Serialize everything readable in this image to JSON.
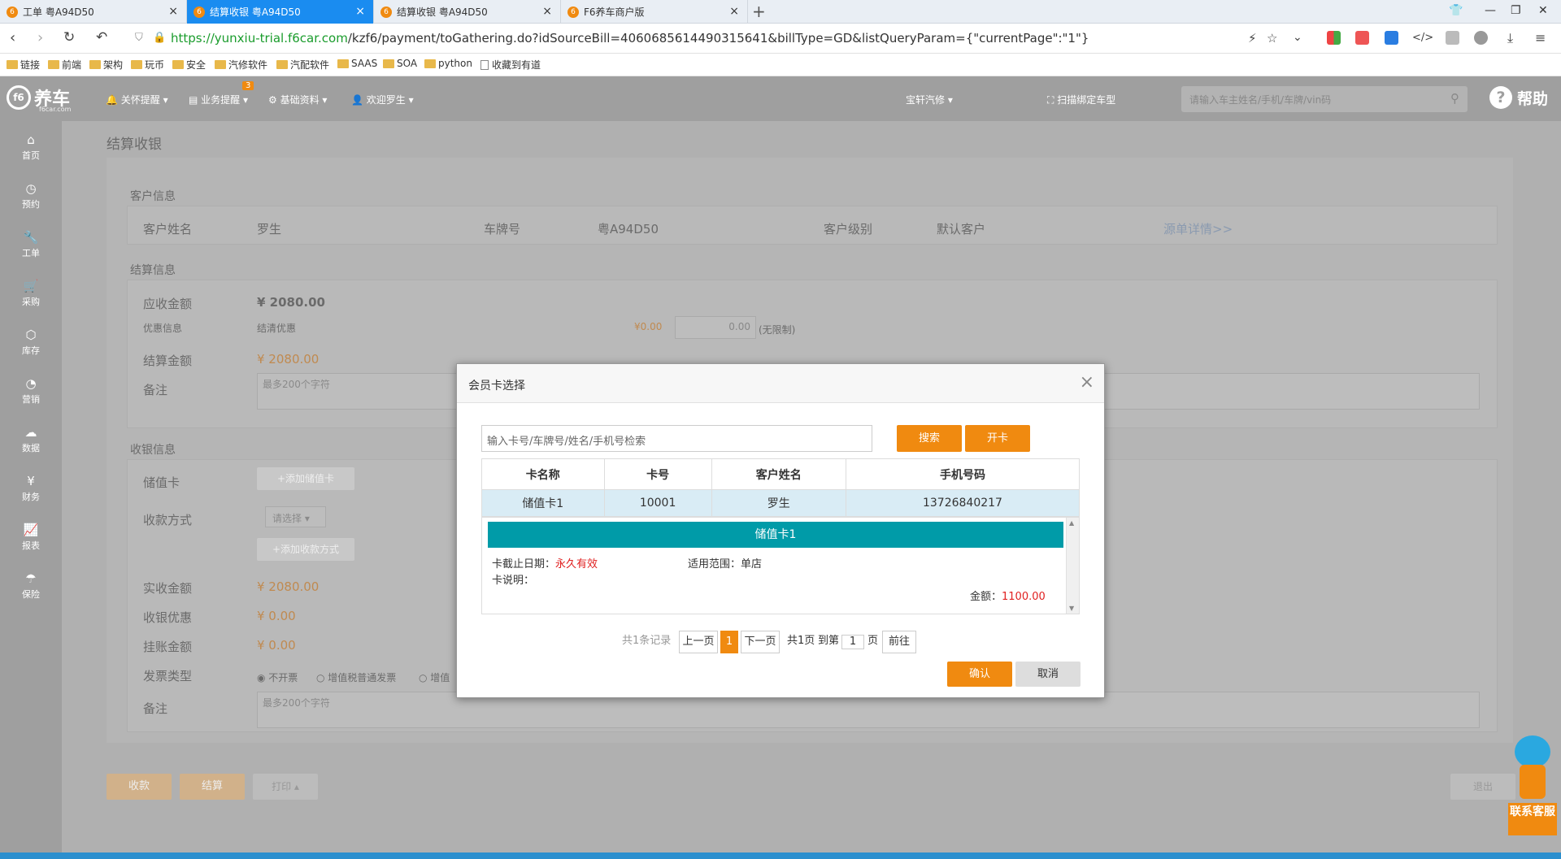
{
  "browser": {
    "tabs": [
      {
        "label": "工单 粤A94D50",
        "active": false
      },
      {
        "label": "结算收银 粤A94D50",
        "active": true
      },
      {
        "label": "结算收银 粤A94D50",
        "active": false
      },
      {
        "label": "F6养车商户版",
        "active": false
      }
    ],
    "url_host": "https://yunxiu-trial.f6car.com",
    "url_path": "/kzf6/payment/toGathering.do?idSourceBill=4060685614490315641&billType=GD&listQueryParam={\"currentPage\":\"1\"}",
    "bookmarks": [
      "链接",
      "前端",
      "架构",
      "玩币",
      "安全",
      "汽修软件",
      "汽配软件",
      "SAAS",
      "SOA",
      "python",
      "收藏到有道"
    ]
  },
  "topnav": {
    "logo": "养车",
    "logo_sub": "f6car.com",
    "items": [
      "关怀提醒",
      "业务提醒",
      "基础资料",
      "欢迎罗生"
    ],
    "badge": "3",
    "store": "宝轩汽修",
    "scan": "扫描绑定车型",
    "search_placeholder": "请输入车主姓名/手机/车牌/vin码",
    "help": "帮助"
  },
  "sidebar": [
    "首页",
    "预约",
    "工单",
    "采购",
    "库存",
    "营销",
    "数据",
    "财务",
    "报表",
    "保险"
  ],
  "page": {
    "title": "结算收银",
    "customer_section": "客户信息",
    "customer_name_label": "客户姓名",
    "customer_name": "罗生",
    "plate_label": "车牌号",
    "plate": "粤A94D50",
    "level_label": "客户级别",
    "level": "默认客户",
    "source_link": "源单详情>>",
    "settle_section": "结算信息",
    "receivable_label": "应收金额",
    "receivable": "¥ 2080.00",
    "discount_label": "优惠信息",
    "discount_value": "结清优惠",
    "discount_amount": "¥0.00",
    "discount_input": "0.00",
    "unlimited": "(无限制)",
    "settle_label": "结算金额",
    "settle_amount": "¥ 2080.00",
    "remark_label": "备注",
    "remark_placeholder": "最多200个字符",
    "cashier_section": "收银信息",
    "stored_card_label": "储值卡",
    "add_card_button": "+添加储值卡",
    "pay_method_label": "收款方式",
    "pay_select": "请选择",
    "add_pay_button": "+添加收款方式",
    "actual_label": "实收金额",
    "actual_amount": "¥ 2080.00",
    "cash_discount_label": "收银优惠",
    "cash_discount": "¥ 0.00",
    "credit_label": "挂账金额",
    "credit_amount": "¥ 0.00",
    "invoice_label": "发票类型",
    "invoice_options": [
      "不开票",
      "增值税普通发票",
      "增值"
    ],
    "remark2_label": "备注",
    "remark2_placeholder": "最多200个字符",
    "collect_button": "收款",
    "settle_button": "结算",
    "print_button": "打印",
    "exit_button": "退出"
  },
  "modal": {
    "title": "会员卡选择",
    "search_placeholder": "输入卡号/车牌号/姓名/手机号检索",
    "search_button": "搜索",
    "open_card_button": "开卡",
    "columns": [
      "卡名称",
      "卡号",
      "客户姓名",
      "手机号码"
    ],
    "rows": [
      [
        "储值卡1",
        "10001",
        "罗生",
        "13726840217"
      ]
    ],
    "detail_title": "储值卡1",
    "expire_label": "卡截止日期：",
    "expire_value": "永久有效",
    "scope_label": "适用范围：",
    "scope_value": "单店",
    "desc_label": "卡说明：",
    "balance_label": "金额：",
    "balance_value": "1100.00",
    "total_records": "共1条记录",
    "prev": "上一页",
    "current_page": "1",
    "next": "下一页",
    "total_pages": "共1页",
    "goto_label": "到第",
    "goto_value": "1",
    "page_unit": "页",
    "go_button": "前往",
    "confirm_button": "确认",
    "cancel_button": "取消"
  },
  "service": {
    "label": "联系客服"
  }
}
